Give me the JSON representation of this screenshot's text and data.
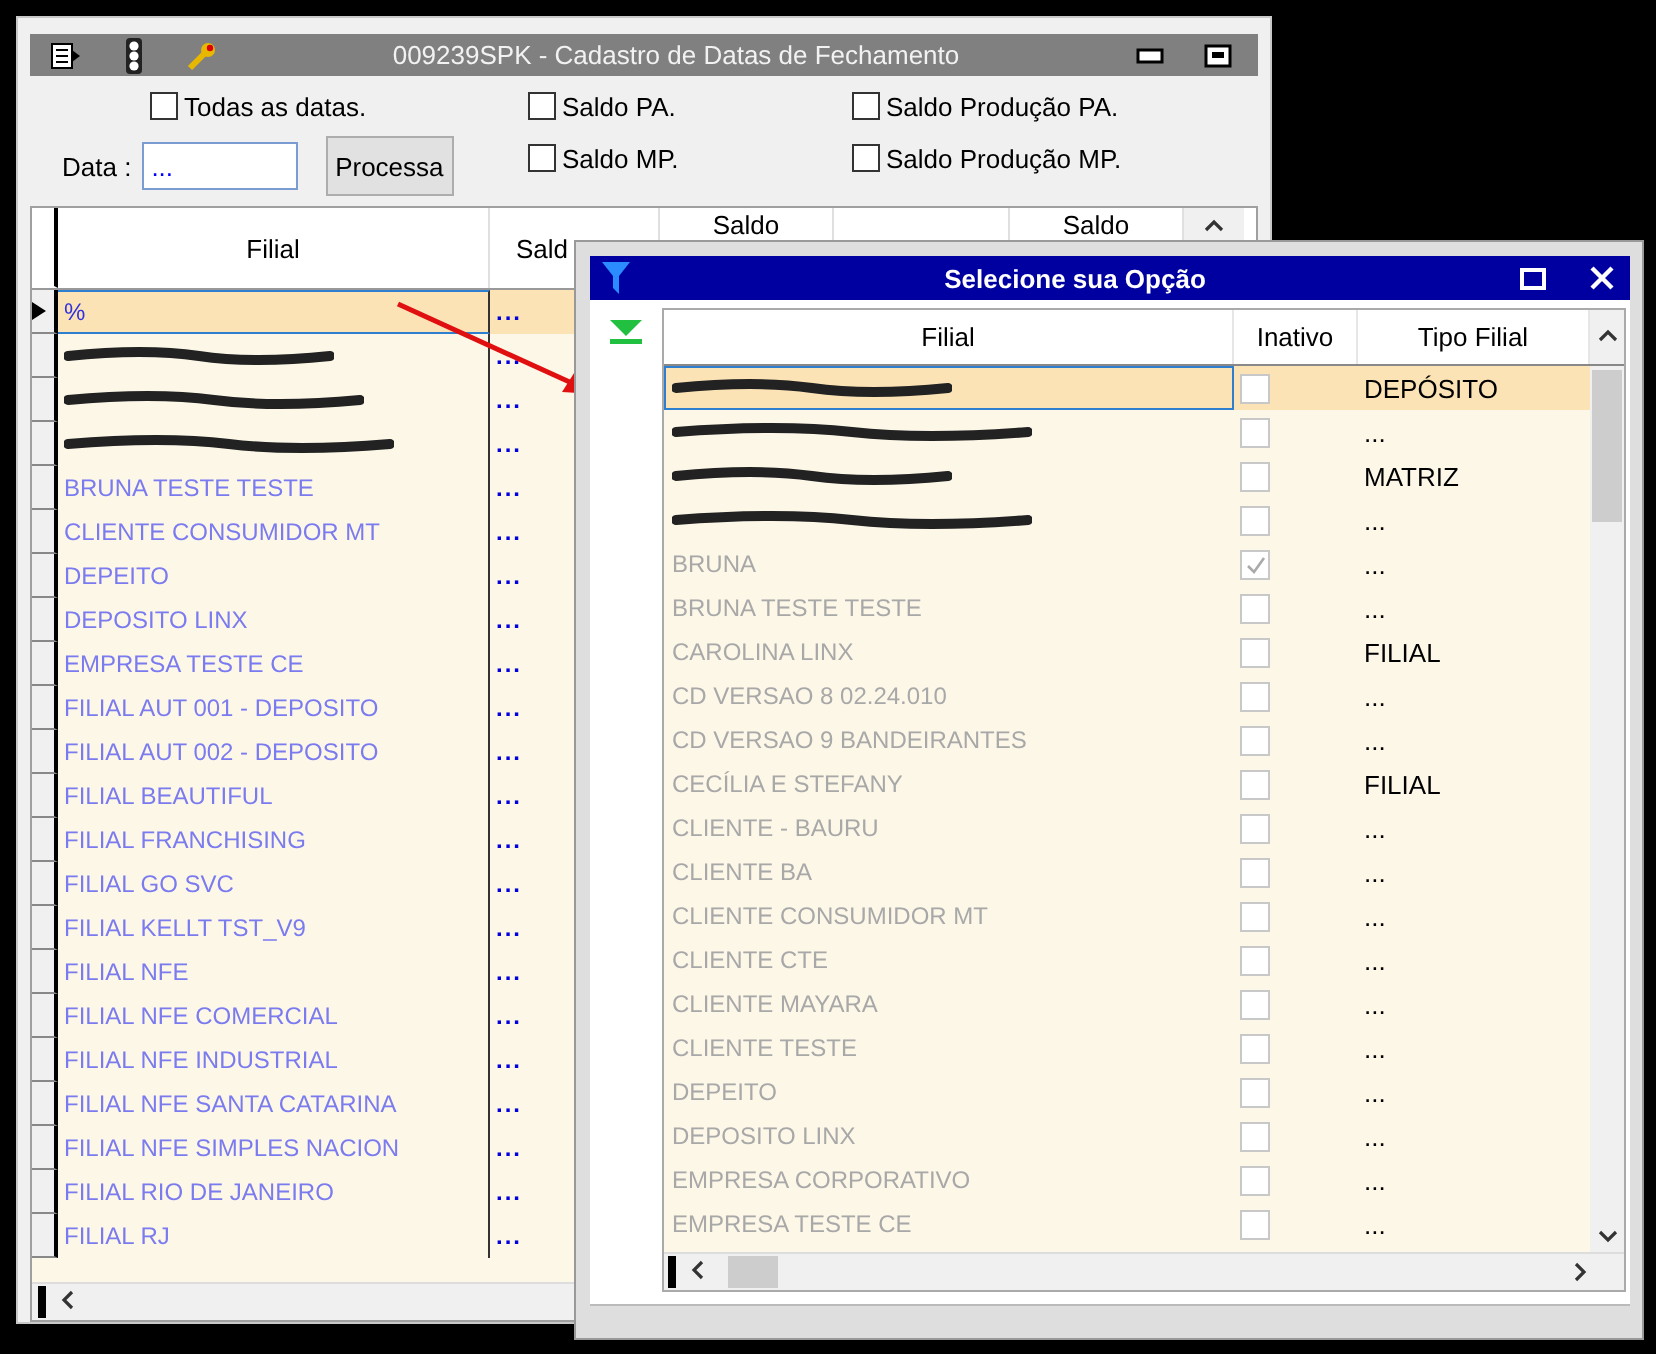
{
  "main_window": {
    "title": "009239SPK - Cadastro de Datas de Fechamento"
  },
  "options": {
    "checkboxes": [
      {
        "label": "Todas as datas.",
        "checked": false
      },
      {
        "label": "Saldo PA.",
        "checked": false
      },
      {
        "label": "Saldo MP.",
        "checked": false
      },
      {
        "label": "Saldo Produção PA.",
        "checked": false
      },
      {
        "label": "Saldo Produção MP.",
        "checked": false
      }
    ],
    "date_label": "Data :",
    "date_value": "...",
    "process_button": "Processa"
  },
  "grid": {
    "columns": [
      {
        "label": "Filial",
        "wrapped": false
      },
      {
        "label": "Sald",
        "wrapped": false
      },
      {
        "label": "Saldo",
        "wrapped": true
      },
      {
        "label": "Saldo",
        "wrapped": true
      }
    ],
    "rows": [
      {
        "filial": "%",
        "redacted": false,
        "value": "...",
        "selected": true
      },
      {
        "redacted": true,
        "value": "...",
        "selected": false
      },
      {
        "redacted": true,
        "value": "...",
        "selected": false
      },
      {
        "redacted": true,
        "value": "...",
        "selected": false
      },
      {
        "filial": "BRUNA TESTE TESTE",
        "redacted": false,
        "value": "...",
        "selected": false
      },
      {
        "filial": "CLIENTE CONSUMIDOR MT",
        "redacted": false,
        "value": "...",
        "selected": false
      },
      {
        "filial": "DEPEITO",
        "redacted": false,
        "value": "...",
        "selected": false
      },
      {
        "filial": "DEPOSITO LINX",
        "redacted": false,
        "value": "...",
        "selected": false
      },
      {
        "filial": "EMPRESA TESTE CE",
        "redacted": false,
        "value": "...",
        "selected": false
      },
      {
        "filial": "FILIAL AUT 001 - DEPOSITO",
        "redacted": false,
        "value": "...",
        "selected": false
      },
      {
        "filial": "FILIAL AUT 002 - DEPOSITO",
        "redacted": false,
        "value": "...",
        "selected": false
      },
      {
        "filial": "FILIAL BEAUTIFUL",
        "redacted": false,
        "value": "...",
        "selected": false
      },
      {
        "filial": "FILIAL FRANCHISING",
        "redacted": false,
        "value": "...",
        "selected": false
      },
      {
        "filial": "FILIAL GO SVC",
        "redacted": false,
        "value": "...",
        "selected": false
      },
      {
        "filial": "FILIAL KELLT TST_V9",
        "redacted": false,
        "value": "...",
        "selected": false
      },
      {
        "filial": "FILIAL NFE",
        "redacted": false,
        "value": "...",
        "selected": false
      },
      {
        "filial": "FILIAL NFE COMERCIAL",
        "redacted": false,
        "value": "...",
        "selected": false
      },
      {
        "filial": "FILIAL NFE INDUSTRIAL",
        "redacted": false,
        "value": "...",
        "selected": false
      },
      {
        "filial": "FILIAL NFE SANTA CATARINA",
        "redacted": false,
        "value": "...",
        "selected": false
      },
      {
        "filial": "FILIAL NFE SIMPLES NACION",
        "redacted": false,
        "value": "...",
        "selected": false
      },
      {
        "filial": "FILIAL RIO DE JANEIRO",
        "redacted": false,
        "value": "...",
        "selected": false
      },
      {
        "filial": "FILIAL RJ",
        "redacted": false,
        "value": "...",
        "selected": false
      }
    ]
  },
  "dialog": {
    "title": "Selecione sua Opção",
    "columns": [
      "Filial",
      "Inativo",
      "Tipo Filial"
    ],
    "rows": [
      {
        "redacted": true,
        "inativo": false,
        "tipo": "DEPÓSITO",
        "selected": true
      },
      {
        "redacted": true,
        "inativo": false,
        "tipo": "...",
        "selected": false
      },
      {
        "redacted": true,
        "inativo": false,
        "tipo": "MATRIZ",
        "selected": false
      },
      {
        "redacted": true,
        "inativo": false,
        "tipo": "...",
        "selected": false
      },
      {
        "filial": "BRUNA",
        "redacted": false,
        "inativo": true,
        "tipo": "...",
        "selected": false
      },
      {
        "filial": "BRUNA TESTE TESTE",
        "redacted": false,
        "inativo": false,
        "tipo": "...",
        "selected": false
      },
      {
        "filial": "CAROLINA LINX",
        "redacted": false,
        "inativo": false,
        "tipo": "FILIAL",
        "selected": false
      },
      {
        "filial": "CD VERSAO 8 02.24.010",
        "redacted": false,
        "inativo": false,
        "tipo": "...",
        "selected": false
      },
      {
        "filial": "CD VERSAO 9 BANDEIRANTES",
        "redacted": false,
        "inativo": false,
        "tipo": "...",
        "selected": false
      },
      {
        "filial": "CECÍLIA E STEFANY",
        "redacted": false,
        "inativo": false,
        "tipo": "FILIAL",
        "selected": false
      },
      {
        "filial": "CLIENTE - BAURU",
        "redacted": false,
        "inativo": false,
        "tipo": "...",
        "selected": false
      },
      {
        "filial": "CLIENTE BA",
        "redacted": false,
        "inativo": false,
        "tipo": "...",
        "selected": false
      },
      {
        "filial": "CLIENTE CONSUMIDOR MT",
        "redacted": false,
        "inativo": false,
        "tipo": "...",
        "selected": false
      },
      {
        "filial": "CLIENTE CTE",
        "redacted": false,
        "inativo": false,
        "tipo": "...",
        "selected": false
      },
      {
        "filial": "CLIENTE MAYARA",
        "redacted": false,
        "inativo": false,
        "tipo": "...",
        "selected": false
      },
      {
        "filial": "CLIENTE TESTE",
        "redacted": false,
        "inativo": false,
        "tipo": "...",
        "selected": false
      },
      {
        "filial": "DEPEITO",
        "redacted": false,
        "inativo": false,
        "tipo": "...",
        "selected": false
      },
      {
        "filial": "DEPOSITO LINX",
        "redacted": false,
        "inativo": false,
        "tipo": "...",
        "selected": false
      },
      {
        "filial": "EMPRESA CORPORATIVO",
        "redacted": false,
        "inativo": false,
        "tipo": "...",
        "selected": false
      },
      {
        "filial": "EMPRESA TESTE CE",
        "redacted": false,
        "inativo": false,
        "tipo": "...",
        "selected": false
      }
    ]
  }
}
